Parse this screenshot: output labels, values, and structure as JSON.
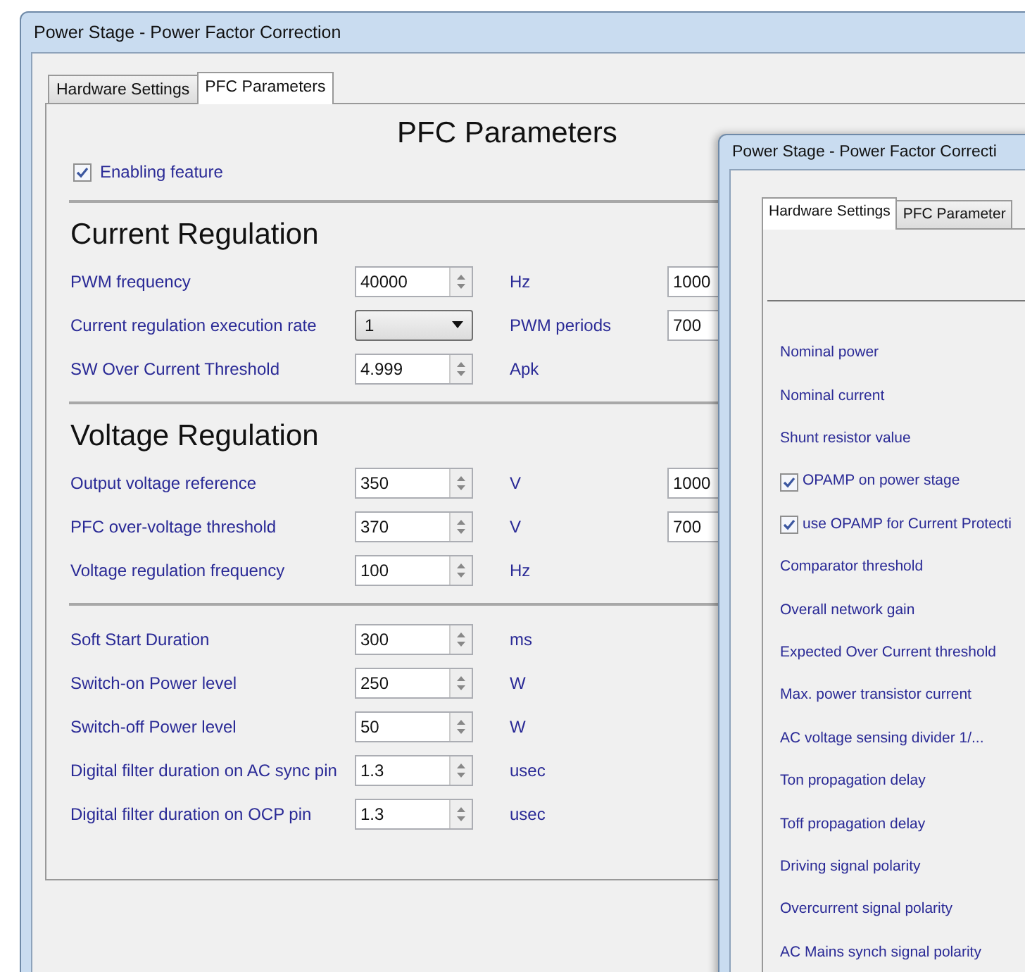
{
  "back_window": {
    "title": "Power Stage - Power Factor Correction",
    "tabs": [
      {
        "label": "Hardware Settings",
        "selected": false
      },
      {
        "label": "PFC Parameters",
        "selected": true
      }
    ],
    "heading": "PFC Parameters",
    "enabling_feature": {
      "label": "Enabling feature",
      "checked": true
    },
    "sections": [
      {
        "title": "Current Regulation",
        "rows": [
          {
            "kind": "spin",
            "label": "PWM frequency",
            "value": "40000",
            "unit": "Hz",
            "extra_value": "1000"
          },
          {
            "kind": "combo",
            "label": "Current regulation execution rate",
            "value": "1",
            "unit": "PWM periods",
            "extra_value": "700"
          },
          {
            "kind": "spin",
            "label": "SW Over Current Threshold",
            "value": "4.999",
            "unit": "Apk"
          }
        ]
      },
      {
        "title": "Voltage Regulation",
        "rows": [
          {
            "kind": "spin",
            "label": "Output voltage reference",
            "value": "350",
            "unit": "V",
            "extra_value": "1000"
          },
          {
            "kind": "spin",
            "label": "PFC over-voltage threshold",
            "value": "370",
            "unit": "V",
            "extra_value": "700"
          },
          {
            "kind": "spin",
            "label": "Voltage regulation frequency",
            "value": "100",
            "unit": "Hz"
          }
        ]
      },
      {
        "rows": [
          {
            "kind": "spin",
            "label": "Soft Start Duration",
            "value": "300",
            "unit": "ms"
          },
          {
            "kind": "spin",
            "label": "Switch-on Power level",
            "value": "250",
            "unit": "W"
          },
          {
            "kind": "spin",
            "label": "Switch-off Power level",
            "value": "50",
            "unit": "W"
          },
          {
            "kind": "spin",
            "label": "Digital filter duration on AC sync pin",
            "value": "1.3",
            "unit": "usec"
          },
          {
            "kind": "spin",
            "label": "Digital filter duration on OCP pin",
            "value": "1.3",
            "unit": "usec"
          }
        ]
      }
    ]
  },
  "front_window": {
    "title": "Power Stage - Power Factor Correcti",
    "tabs": [
      {
        "label": "Hardware Settings",
        "selected": true
      },
      {
        "label": "PFC Parameter",
        "selected": false
      }
    ],
    "rows": [
      {
        "kind": "label",
        "label": "Nominal power"
      },
      {
        "kind": "label",
        "label": "Nominal current"
      },
      {
        "kind": "label",
        "label": "Shunt resistor value"
      },
      {
        "kind": "checkbox",
        "label": "OPAMP on power stage",
        "checked": true
      },
      {
        "kind": "checkbox",
        "label": "use OPAMP for Current Protecti",
        "checked": true
      },
      {
        "kind": "label",
        "label": "Comparator threshold"
      },
      {
        "kind": "label",
        "label": "Overall network gain"
      },
      {
        "kind": "label",
        "label": "Expected Over Current threshold"
      },
      {
        "kind": "label",
        "label": "Max. power transistor current"
      },
      {
        "kind": "label",
        "label": "AC voltage sensing divider 1/..."
      },
      {
        "kind": "label",
        "label": "Ton propagation delay"
      },
      {
        "kind": "label",
        "label": "Toff propagation delay"
      },
      {
        "kind": "label",
        "label": "Driving signal polarity"
      },
      {
        "kind": "label",
        "label": "Overcurrent signal polarity"
      },
      {
        "kind": "label",
        "label": "AC Mains synch signal polarity"
      }
    ]
  }
}
